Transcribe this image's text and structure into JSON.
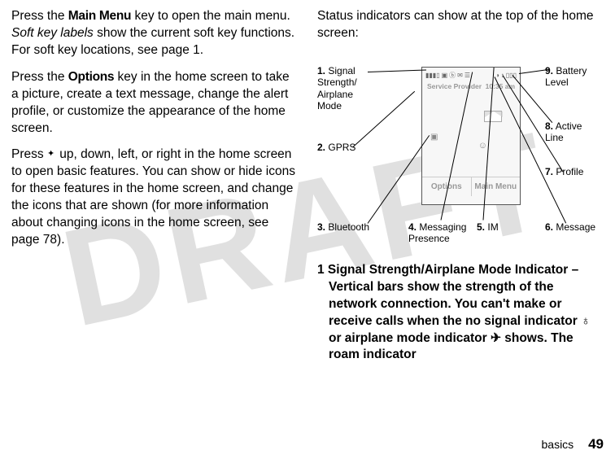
{
  "watermark": "DRAFT",
  "left": {
    "p1_a": "Press the ",
    "p1_mainmenu": "Main Menu",
    "p1_b": " key to open the main menu. ",
    "p1_softkeylabels": "Soft key labels",
    "p1_c": " show the current soft key functions. For soft key locations, see page 1.",
    "p2_a": "Press the ",
    "p2_options": "Options",
    "p2_b": " key in the home screen to take a picture, create a text message, change the alert profile, or customize the appearance of the home screen.",
    "p3_a": "Press ",
    "p3_b": " up, down, left, or right in the home screen to open basic features. You can show or hide icons for these features in the home screen, and change the icons that are shown (for more information about changing icons in the home screen, see page 78)."
  },
  "right": {
    "intro": "Status indicators can show at the top of the home screen:",
    "callouts": {
      "c1_num": "1.",
      "c1_txt": "Signal Strength/ Airplane Mode",
      "c2_num": "2.",
      "c2_txt": "GPRS",
      "c3_num": "3.",
      "c3_txt": "Bluetooth",
      "c4_num": "4.",
      "c4_txt": "Messaging Presence",
      "c5_num": "5.",
      "c5_txt": "IM",
      "c6_num": "6.",
      "c6_txt": "Message",
      "c7_num": "7.",
      "c7_txt": "Profile",
      "c8_num": "8.",
      "c8_txt": "Active Line",
      "c9_num": "9.",
      "c9_txt": "Battery Level"
    },
    "phone": {
      "provider": "Service Provider",
      "time": "10:35 am",
      "soft_left": "Options",
      "soft_right": "Main Menu"
    },
    "def_lead": "1   Signal Strength/Airplane Mode Indicator –",
    "def_body": " Vertical bars show the strength of the network connection. You can't make or receive calls when the no signal indicator ♁ or airplane mode indicator ✈ shows. The roam indicator"
  },
  "footer": {
    "section": "basics",
    "page": "49"
  }
}
